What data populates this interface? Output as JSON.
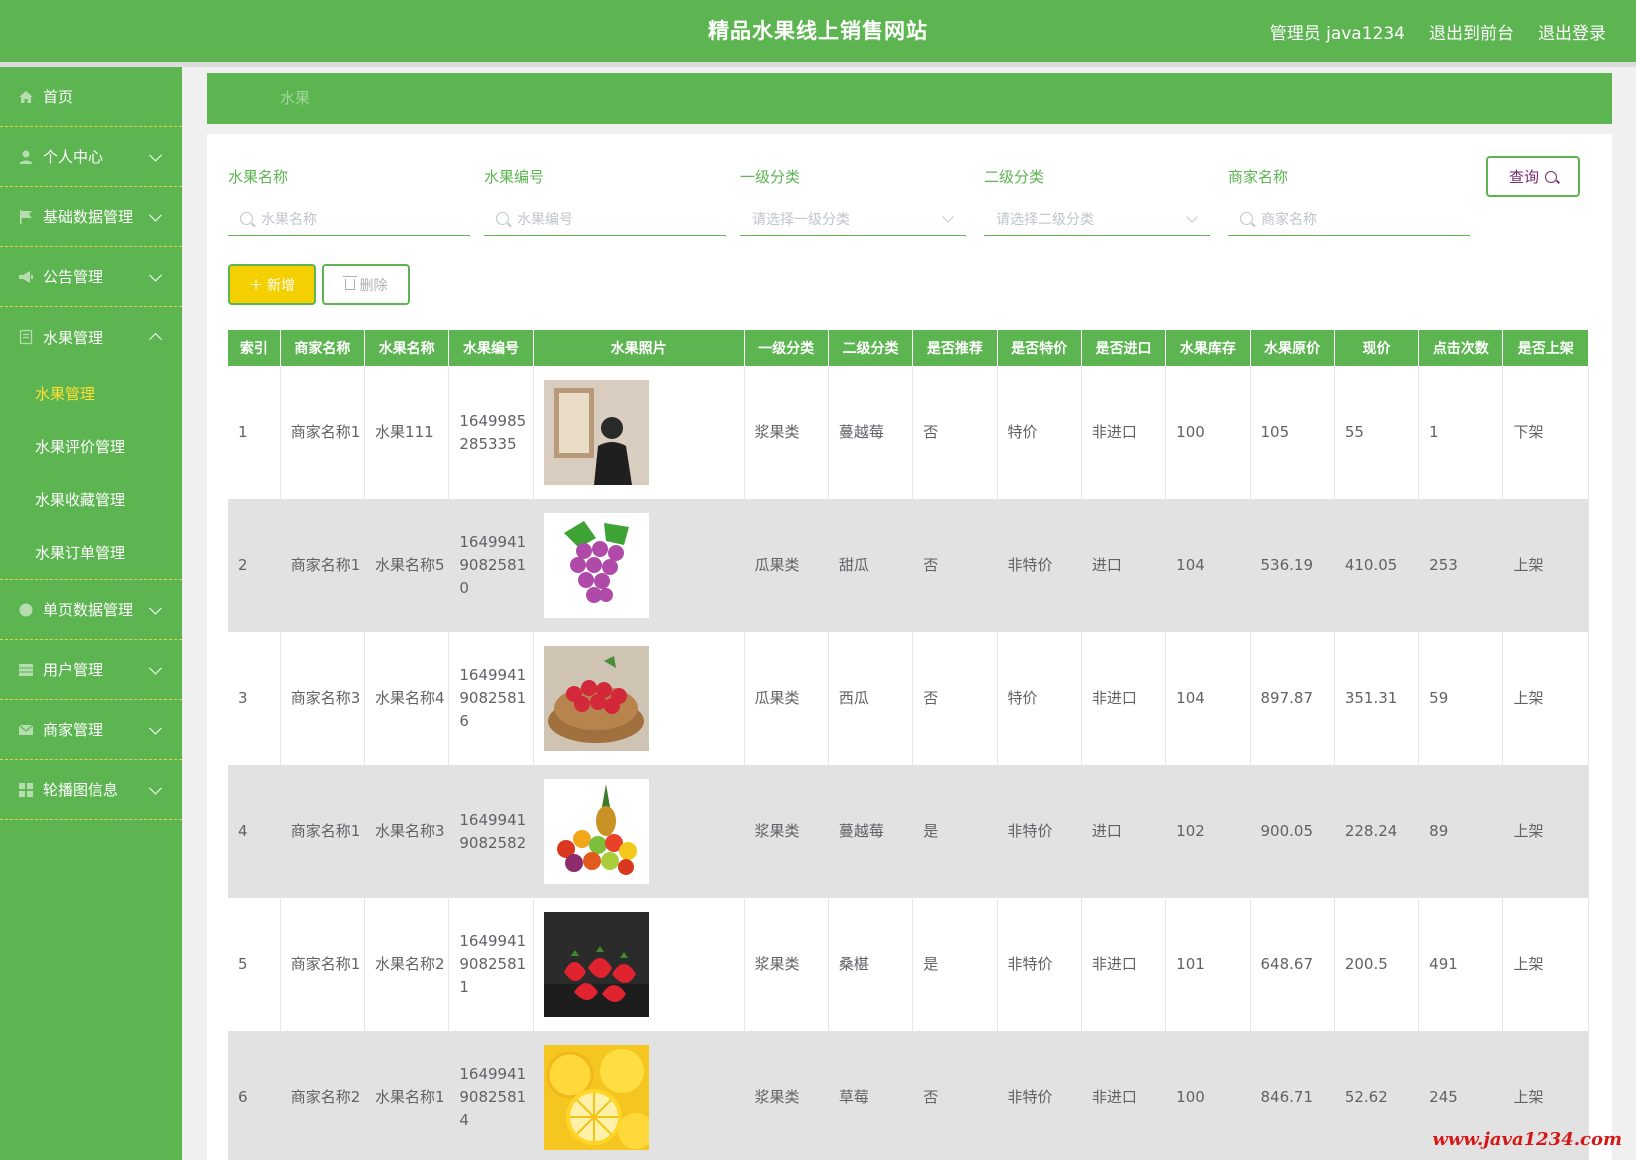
{
  "header": {
    "title": "精品水果线上销售网站",
    "user": "管理员 java1234",
    "front_link": "退出到前台",
    "logout_link": "退出登录"
  },
  "sidebar": {
    "items": [
      {
        "label": "首页",
        "icon": "home-icon",
        "expandable": false
      },
      {
        "label": "个人中心",
        "icon": "user-icon",
        "expandable": true
      },
      {
        "label": "基础数据管理",
        "icon": "flag-icon",
        "expandable": true
      },
      {
        "label": "公告管理",
        "icon": "megaphone-icon",
        "expandable": true
      },
      {
        "label": "水果管理",
        "icon": "document-icon",
        "expandable": true,
        "expanded": true,
        "children": [
          "水果管理",
          "水果评价管理",
          "水果收藏管理",
          "水果订单管理"
        ],
        "active_child": 0
      },
      {
        "label": "单页数据管理",
        "icon": "globe-icon",
        "expandable": true
      },
      {
        "label": "用户管理",
        "icon": "grid-icon",
        "expandable": true
      },
      {
        "label": "商家管理",
        "icon": "mail-icon",
        "expandable": true
      },
      {
        "label": "轮播图信息",
        "icon": "apps-icon",
        "expandable": true
      }
    ]
  },
  "breadcrumb": "水果",
  "search": {
    "fields": [
      {
        "label": "水果名称",
        "placeholder": "水果名称",
        "type": "text"
      },
      {
        "label": "水果编号",
        "placeholder": "水果编号",
        "type": "text"
      },
      {
        "label": "一级分类",
        "placeholder": "请选择一级分类",
        "type": "select"
      },
      {
        "label": "二级分类",
        "placeholder": "请选择二级分类",
        "type": "select"
      },
      {
        "label": "商家名称",
        "placeholder": "商家名称",
        "type": "text"
      }
    ],
    "query_label": "查询"
  },
  "actions": {
    "add_label": "新增",
    "delete_label": "删除"
  },
  "table": {
    "headers": [
      "索引",
      "商家名称",
      "水果名称",
      "水果编号",
      "水果照片",
      "一级分类",
      "二级分类",
      "是否推荐",
      "是否特价",
      "是否进口",
      "水果库存",
      "水果原价",
      "现价",
      "点击次数",
      "是否上架"
    ],
    "rows": [
      [
        "1",
        "商家名称1",
        "水果111",
        "1649985285335",
        "photo-person",
        "浆果类",
        "蔓越莓",
        "否",
        "特价",
        "非进口",
        "100",
        "105",
        "55",
        "1",
        "下架"
      ],
      [
        "2",
        "商家名称1",
        "水果名称5",
        "16499419082581 0",
        "photo-grapes",
        "瓜果类",
        "甜瓜",
        "否",
        "非特价",
        "进口",
        "104",
        "536.19",
        "410.05",
        "253",
        "上架"
      ],
      [
        "3",
        "商家名称3",
        "水果名称4",
        "16499419082581 6",
        "photo-raspberries",
        "瓜果类",
        "西瓜",
        "否",
        "特价",
        "非进口",
        "104",
        "897.87",
        "351.31",
        "59",
        "上架"
      ],
      [
        "4",
        "商家名称1",
        "水果名称3",
        "16499419082582",
        "photo-fruit-pile",
        "浆果类",
        "蔓越莓",
        "是",
        "非特价",
        "进口",
        "102",
        "900.05",
        "228.24",
        "89",
        "上架"
      ],
      [
        "5",
        "商家名称1",
        "水果名称2",
        "16499419082581 1",
        "photo-strawberries",
        "浆果类",
        "桑椹",
        "是",
        "非特价",
        "非进口",
        "101",
        "648.67",
        "200.5",
        "491",
        "上架"
      ],
      [
        "6",
        "商家名称2",
        "水果名称1",
        "16499419082581 4",
        "photo-lemons",
        "浆果类",
        "草莓",
        "否",
        "非特价",
        "非进口",
        "100",
        "846.71",
        "52.62",
        "245",
        "上架"
      ]
    ]
  },
  "watermark": "www.java1234.com",
  "colors": {
    "primary": "#5cb551",
    "accent": "#f5d000",
    "active_menu": "#ffe033"
  }
}
